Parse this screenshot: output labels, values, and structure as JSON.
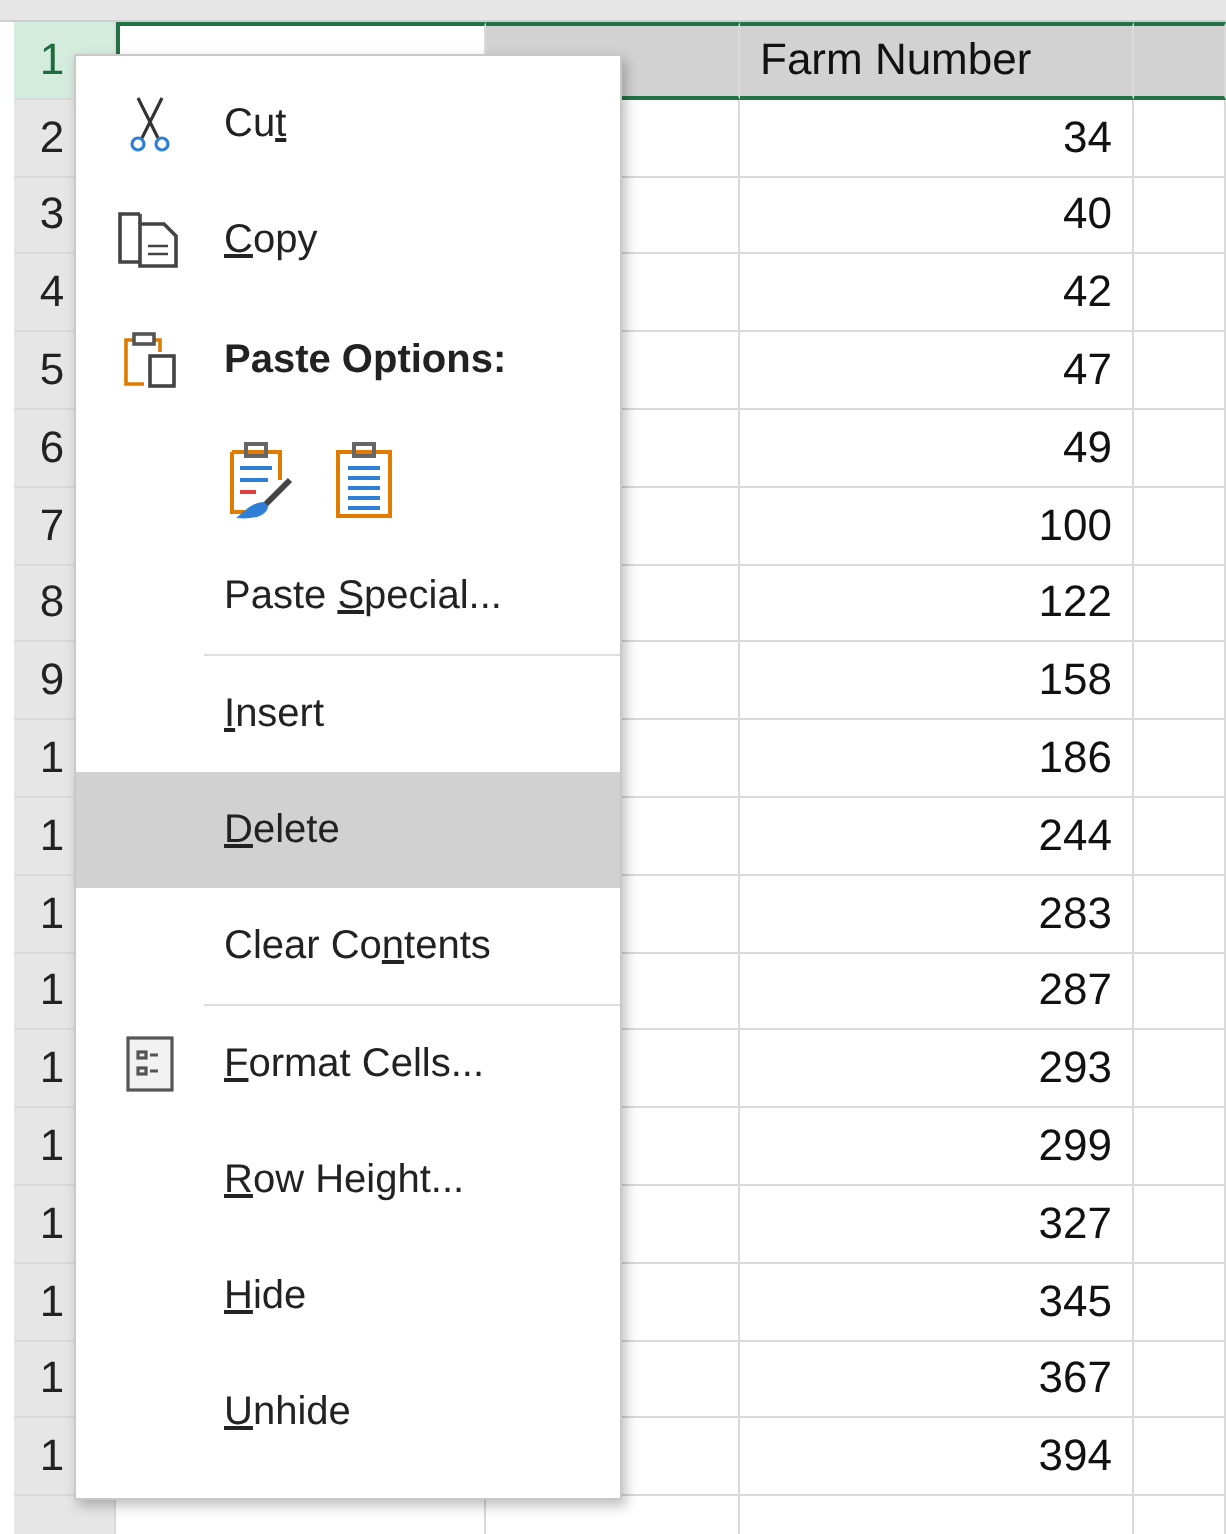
{
  "sheet": {
    "rows": [
      {
        "row_header": "1",
        "selected": true,
        "column_c": "Farm Number"
      },
      {
        "row_header": "2",
        "selected": false,
        "column_c": "34"
      },
      {
        "row_header": "3",
        "selected": false,
        "column_c": "40"
      },
      {
        "row_header": "4",
        "selected": false,
        "column_c": "42"
      },
      {
        "row_header": "5",
        "selected": false,
        "column_c": "47"
      },
      {
        "row_header": "6",
        "selected": false,
        "column_c": "49"
      },
      {
        "row_header": "7",
        "selected": false,
        "column_c": "100"
      },
      {
        "row_header": "8",
        "selected": false,
        "column_c": "122"
      },
      {
        "row_header": "9",
        "selected": false,
        "column_c": "158"
      },
      {
        "row_header": "1",
        "selected": false,
        "column_c": "186"
      },
      {
        "row_header": "1",
        "selected": false,
        "column_c": "244"
      },
      {
        "row_header": "1",
        "selected": false,
        "column_c": "283"
      },
      {
        "row_header": "1",
        "selected": false,
        "column_c": "287"
      },
      {
        "row_header": "1",
        "selected": false,
        "column_c": "293"
      },
      {
        "row_header": "1",
        "selected": false,
        "column_c": "299"
      },
      {
        "row_header": "1",
        "selected": false,
        "column_c": "327"
      },
      {
        "row_header": "1",
        "selected": false,
        "column_c": "345"
      },
      {
        "row_header": "1",
        "selected": false,
        "column_c": "367"
      },
      {
        "row_header": "1",
        "selected": false,
        "column_c": "394"
      }
    ]
  },
  "context_menu": {
    "items": [
      {
        "kind": "icon-item",
        "before": "Cu",
        "key": "t",
        "selected": false
      },
      {
        "kind": "icon-item",
        "key": "C",
        "after": "opy",
        "selected": false
      },
      {
        "kind": "heading",
        "label": "Paste Options:"
      },
      {
        "kind": "paste-icons"
      },
      {
        "kind": "item",
        "before": "Paste ",
        "key": "S",
        "after": "pecial...",
        "selected": false
      },
      {
        "kind": "separator"
      },
      {
        "kind": "item",
        "key": "I",
        "after": "nsert",
        "selected": false
      },
      {
        "kind": "item",
        "key": "D",
        "after": "elete",
        "selected": true
      },
      {
        "kind": "item",
        "before": "Clear Co",
        "key": "n",
        "after": "tents",
        "selected": false
      },
      {
        "kind": "separator"
      },
      {
        "kind": "icon-item",
        "key": "F",
        "after": "ormat Cells...",
        "selected": false
      },
      {
        "kind": "item",
        "key": "R",
        "after": "ow Height...",
        "selected": false
      },
      {
        "kind": "item",
        "key": "H",
        "after": "ide",
        "selected": false
      },
      {
        "kind": "item",
        "key": "U",
        "after": "nhide",
        "selected": false
      }
    ]
  }
}
